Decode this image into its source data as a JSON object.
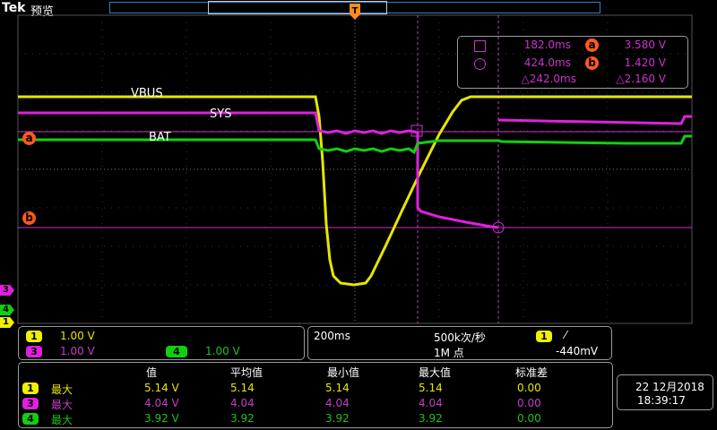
{
  "header": {
    "brand": "Tek",
    "mode": "预览",
    "trigger_marker": "T"
  },
  "traces": {
    "vbus_label": "VBUS",
    "sys_label": "SYS",
    "bat_label": "BAT"
  },
  "cursor_labels": {
    "a": "a",
    "b": "b"
  },
  "cursor_readout": {
    "a_time": "182.0ms",
    "a_value": "3.580 V",
    "b_time": "424.0ms",
    "b_value": "1.420 V",
    "delta_time": "△242.0ms",
    "delta_value": "△2.160 V"
  },
  "channels": {
    "ch1": {
      "num": "1",
      "scale": "1.00 V",
      "color": "#f0f000"
    },
    "ch3": {
      "num": "3",
      "scale": "1.00 V",
      "color": "#e020e0"
    },
    "ch4": {
      "num": "4",
      "scale": "1.00 V",
      "color": "#10d010"
    }
  },
  "timebase": {
    "scale": "200ms",
    "sample_rate": "500k次/秒",
    "record_length": "1M 点",
    "trigger_source": "1",
    "trigger_slope": "⁄",
    "trigger_level": "-440mV"
  },
  "measurements": {
    "headers": [
      "值",
      "平均值",
      "最小值",
      "最大值",
      "标准差"
    ],
    "rows": [
      {
        "ch": "1",
        "name": "最大",
        "value": "5.14 V",
        "mean": "5.14",
        "min": "5.14",
        "max": "5.14",
        "std": "0.00"
      },
      {
        "ch": "3",
        "name": "最大",
        "value": "4.04 V",
        "mean": "4.04",
        "min": "4.04",
        "max": "4.04",
        "std": "0.00"
      },
      {
        "ch": "4",
        "name": "最大",
        "value": "3.92 V",
        "mean": "3.92",
        "min": "3.92",
        "max": "3.92",
        "std": "0.00"
      }
    ]
  },
  "datetime": {
    "date": "22 12月2018",
    "time": "18:39:17"
  },
  "colors": {
    "ch1": "#f0f000",
    "ch3": "#e020e0",
    "ch4": "#10d010",
    "cursor": "#cc33cc",
    "cursor_label": "#ff5a1e",
    "trigger": "#ff8c1a"
  }
}
